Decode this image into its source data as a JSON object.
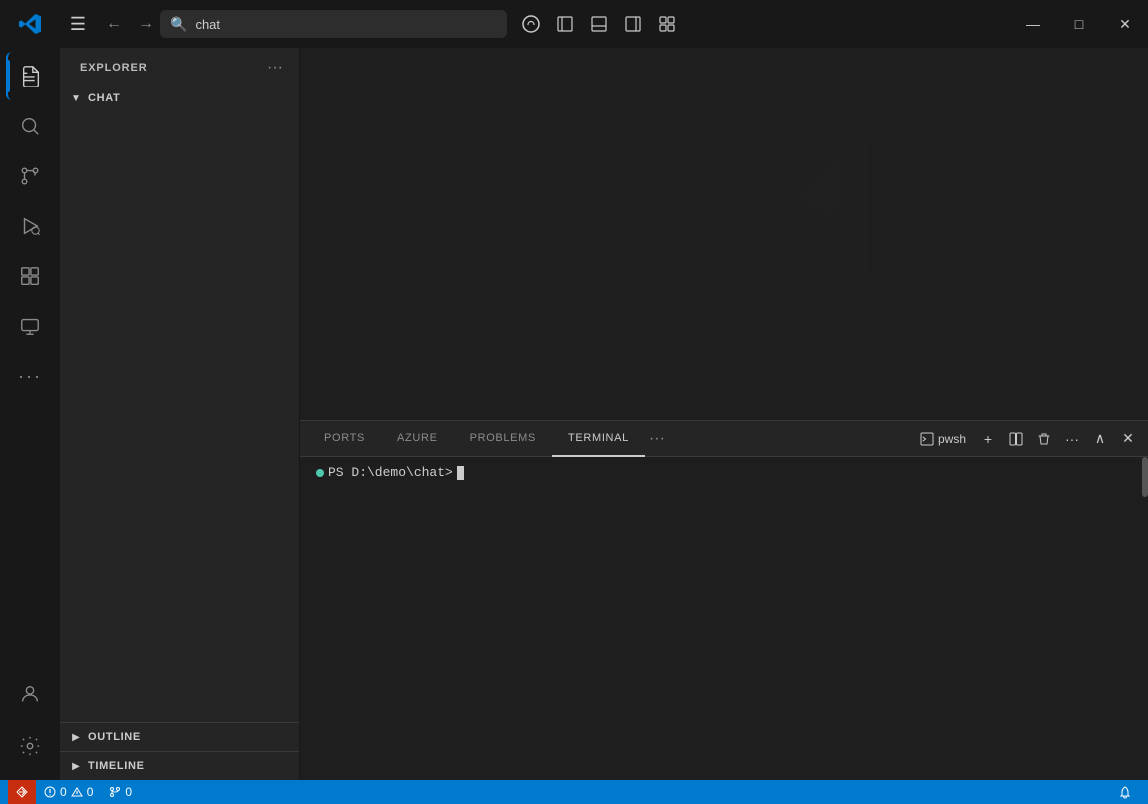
{
  "titlebar": {
    "search_text": "chat",
    "search_placeholder": "chat",
    "nav_back_label": "←",
    "nav_forward_label": "→",
    "menu_label": "☰",
    "window_minimize": "—",
    "window_maximize": "□",
    "window_close": "✕"
  },
  "activity_bar": {
    "items": [
      {
        "id": "explorer",
        "label": "Explorer",
        "icon": "files",
        "active": true
      },
      {
        "id": "search",
        "label": "Search",
        "icon": "search",
        "active": false
      },
      {
        "id": "source-control",
        "label": "Source Control",
        "icon": "source-control",
        "active": false
      },
      {
        "id": "run",
        "label": "Run and Debug",
        "icon": "run",
        "active": false
      },
      {
        "id": "extensions",
        "label": "Extensions",
        "icon": "extensions",
        "active": false
      },
      {
        "id": "remote",
        "label": "Remote Explorer",
        "icon": "remote",
        "active": false
      }
    ],
    "bottom_items": [
      {
        "id": "accounts",
        "label": "Accounts",
        "icon": "person"
      },
      {
        "id": "settings",
        "label": "Settings",
        "icon": "gear"
      },
      {
        "id": "more",
        "label": "More",
        "icon": "ellipsis"
      }
    ]
  },
  "sidebar": {
    "header_title": "EXPLORER",
    "more_label": "···",
    "sections": [
      {
        "id": "chat",
        "label": "CHAT",
        "expanded": true,
        "arrow": "▼"
      }
    ],
    "bottom_sections": [
      {
        "id": "outline",
        "label": "OUTLINE",
        "arrow": "▶"
      },
      {
        "id": "timeline",
        "label": "TIMELINE",
        "arrow": "▶"
      }
    ]
  },
  "terminal": {
    "tabs": [
      {
        "id": "ports",
        "label": "PORTS",
        "active": false
      },
      {
        "id": "azure",
        "label": "AZURE",
        "active": false
      },
      {
        "id": "problems",
        "label": "PROBLEMS",
        "active": false
      },
      {
        "id": "terminal",
        "label": "TERMINAL",
        "active": true
      }
    ],
    "more_label": "···",
    "toolbar": {
      "shell_name": "pwsh",
      "add_label": "+",
      "split_label": "⧉",
      "delete_label": "🗑",
      "more_label": "···",
      "collapse_label": "∧",
      "close_label": "✕"
    },
    "prompt": "PS D:\\demo\\chat> "
  },
  "statusbar": {
    "items_left": [
      {
        "id": "remote",
        "label": "⊗",
        "text": ""
      },
      {
        "id": "errors",
        "label": "⊗ 0  ⚠ 0",
        "icon": "error"
      },
      {
        "id": "git",
        "label": "⎇ 0"
      }
    ],
    "items_right": [
      {
        "id": "notifications",
        "label": "🔔"
      }
    ]
  }
}
